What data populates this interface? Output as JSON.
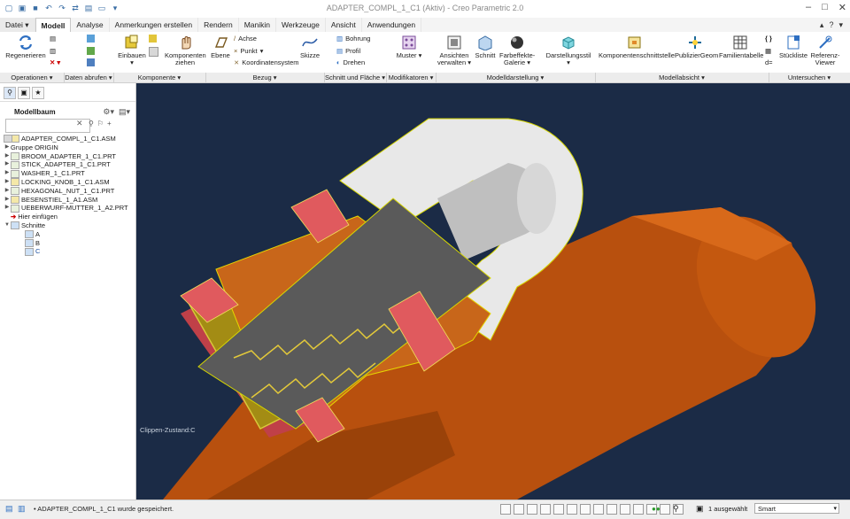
{
  "window": {
    "title": "ADAPTER_COMPL_1_C1 (Aktiv) - Creo Parametric 2.0"
  },
  "tabs": [
    {
      "label": "Datei",
      "dd": "▾"
    },
    {
      "label": "Modell"
    },
    {
      "label": "Analyse"
    },
    {
      "label": "Anmerkungen erstellen"
    },
    {
      "label": "Rendern"
    },
    {
      "label": "Manikin"
    },
    {
      "label": "Werkzeuge"
    },
    {
      "label": "Ansicht"
    },
    {
      "label": "Anwendungen"
    }
  ],
  "ribbon": {
    "regenerieren": "Regenerieren",
    "einbauen": "Einbauen",
    "komp_ziehen_1": "Komponenten",
    "komp_ziehen_2": "ziehen",
    "ebene": "Ebene",
    "achse": "Achse",
    "punkt": "Punkt",
    "koordinatensystem": "Koordinatensystem",
    "skizze": "Skizze",
    "bohrung": "Bohrung",
    "profil": "Profil",
    "drehen": "Drehen",
    "muster": "Muster",
    "ansichten_1": "Ansichten",
    "ansichten_2": "verwalten",
    "schnitt": "Schnitt",
    "farbeffekte_1": "Farbeffekte-",
    "farbeffekte_2": "Galerie",
    "darstellungsstil": "Darstellungsstil",
    "komponentenschnittstelle": "Komponentenschnittstelle",
    "publiziergeom": "PublizierGeom",
    "familientabelle": "Familientabelle",
    "stueckliste": "Stückliste",
    "referenz_1": "Referenz-",
    "referenz_2": "Viewer"
  },
  "groups": [
    {
      "label": "Operationen ▾"
    },
    {
      "label": "Daten abrufen ▾"
    },
    {
      "label": "Komponente ▾"
    },
    {
      "label": "Bezug ▾"
    },
    {
      "label": "Schnitt und Fläche ▾"
    },
    {
      "label": "Modifikatoren ▾"
    },
    {
      "label": "Modelldarstellung ▾"
    },
    {
      "label": "Modellabsicht ▾"
    },
    {
      "label": "Untersuchen ▾"
    }
  ],
  "panel": {
    "title": "Modellbaum",
    "tree": [
      {
        "label": "ADAPTER_COMPL_1_C1.ASM",
        "exp": "",
        "type": "asm"
      },
      {
        "label": "Gruppe ORIGIN",
        "exp": "▶",
        "type": "grp"
      },
      {
        "label": "BROOM_ADAPTER_1_C1.PRT",
        "exp": "▶",
        "type": "prt"
      },
      {
        "label": "STICK_ADAPTER_1_C1.PRT",
        "exp": "▶",
        "type": "prt"
      },
      {
        "label": "WASHER_1_C1.PRT",
        "exp": "▶",
        "type": "prt"
      },
      {
        "label": "LOCKING_KNOB_1_C1.ASM",
        "exp": "▶",
        "type": "asm"
      },
      {
        "label": "HEXAGONAL_NUT_1_C1.PRT",
        "exp": "▶",
        "type": "prt"
      },
      {
        "label": "BESENSTIEL_1_A1.ASM",
        "exp": "▶",
        "type": "asm"
      },
      {
        "label": "UEBERWURF-MUTTER_1_A2.PRT",
        "exp": "▶",
        "type": "prt"
      },
      {
        "label": "Hier einfügen",
        "exp": "",
        "type": "insert"
      },
      {
        "label": "Schnitte",
        "exp": "▼",
        "type": "sec"
      },
      {
        "label": "A",
        "exp": "",
        "type": "sec",
        "indent": true
      },
      {
        "label": "B",
        "exp": "",
        "type": "sec",
        "indent": true
      },
      {
        "label": "C",
        "exp": "",
        "type": "sec",
        "indent": true,
        "selected": true
      }
    ]
  },
  "viewport": {
    "label": "Clippen-Zustand:C"
  },
  "status": {
    "message": "• ADAPTER_COMPL_1_C1 wurde gespeichert.",
    "selection": "1 ausgewählt",
    "filter": "Smart"
  },
  "colors": {
    "viewport_bg": "#1b2b46",
    "orange_part": "#b8500e",
    "red_part": "#e05a5e",
    "gold_part": "#a38c14",
    "gray_part": "#5a5a5a",
    "light_part": "#e8e8e8"
  }
}
